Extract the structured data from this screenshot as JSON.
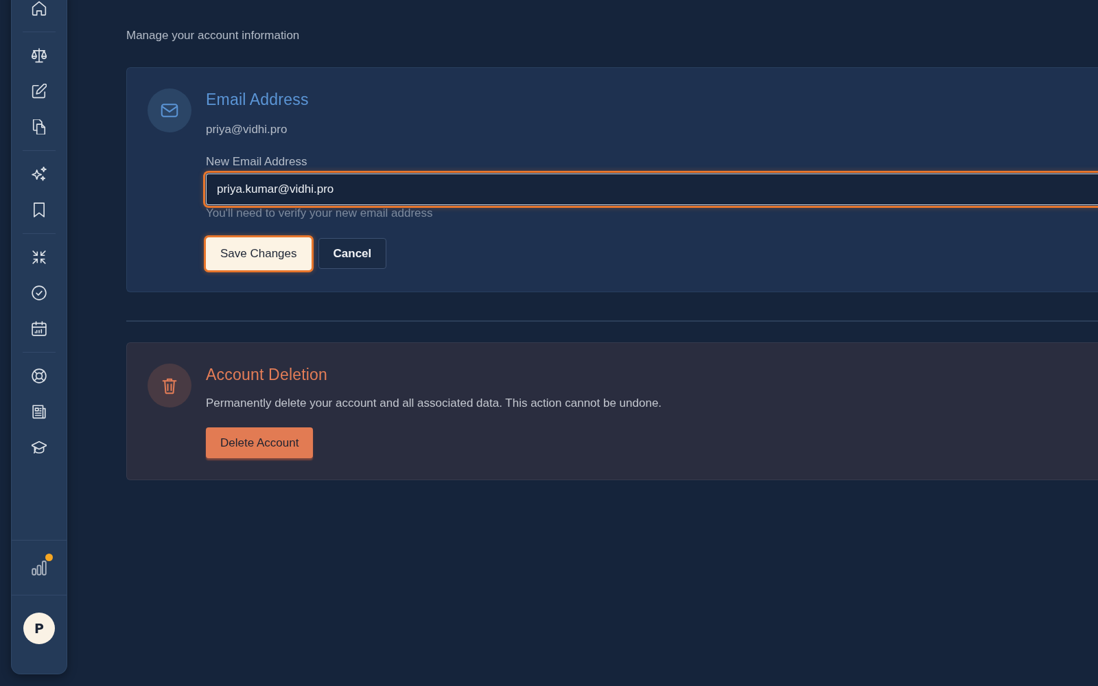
{
  "sidebar": {
    "notification": true,
    "avatar": {
      "initial": "P"
    }
  },
  "subtitle": "Manage your account information",
  "email_section": {
    "title": "Email Address",
    "current_email": "priya@vidhi.pro",
    "field": {
      "label": "New Email Address",
      "value": "priya.kumar@vidhi.pro",
      "focused": true
    },
    "hint": "You'll need to verify your new email address",
    "buttons": [
      {
        "label": "Save Changes",
        "kind": "primary"
      },
      {
        "label": "Cancel",
        "kind": "secondary"
      }
    ]
  },
  "deletion_section": {
    "title": "Account Deletion",
    "description": "Permanently delete your account and all associated data. This action cannot be undone.",
    "buttons": [
      {
        "label": "Delete Account",
        "kind": "danger"
      }
    ]
  }
}
